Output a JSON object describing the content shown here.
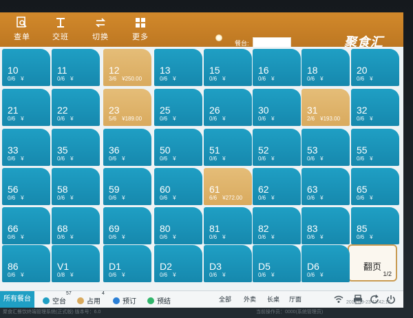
{
  "toolbar": {
    "tools": [
      {
        "label": "查单",
        "icon": "search-doc-icon"
      },
      {
        "label": "交班",
        "icon": "handover-icon"
      },
      {
        "label": "切换",
        "icon": "switch-icon"
      },
      {
        "label": "更多",
        "icon": "more-grid-icon"
      }
    ],
    "table_label": "餐台:",
    "table_input_value": "",
    "brand": "聚食汇"
  },
  "tiles": [
    {
      "name": "10",
      "guests": "0/6",
      "price": "¥",
      "status": "free"
    },
    {
      "name": "11",
      "guests": "0/6",
      "price": "¥",
      "status": "free"
    },
    {
      "name": "12",
      "guests": "3/6",
      "price": "¥250.00",
      "status": "occupied"
    },
    {
      "name": "13",
      "guests": "0/6",
      "price": "¥",
      "status": "free"
    },
    {
      "name": "15",
      "guests": "0/6",
      "price": "¥",
      "status": "free"
    },
    {
      "name": "16",
      "guests": "0/6",
      "price": "¥",
      "status": "free"
    },
    {
      "name": "18",
      "guests": "0/6",
      "price": "¥",
      "status": "free"
    },
    {
      "name": "20",
      "guests": "0/6",
      "price": "¥",
      "status": "free"
    },
    {
      "name": "21",
      "guests": "0/6",
      "price": "¥",
      "status": "free"
    },
    {
      "name": "22",
      "guests": "0/6",
      "price": "¥",
      "status": "free"
    },
    {
      "name": "23",
      "guests": "5/6",
      "price": "¥189.00",
      "status": "occupied"
    },
    {
      "name": "25",
      "guests": "0/6",
      "price": "¥",
      "status": "free"
    },
    {
      "name": "26",
      "guests": "0/6",
      "price": "¥",
      "status": "free"
    },
    {
      "name": "30",
      "guests": "0/6",
      "price": "¥",
      "status": "free"
    },
    {
      "name": "31",
      "guests": "2/6",
      "price": "¥193.00",
      "status": "occupied"
    },
    {
      "name": "32",
      "guests": "0/6",
      "price": "¥",
      "status": "free"
    },
    {
      "name": "33",
      "guests": "0/6",
      "price": "¥",
      "status": "free"
    },
    {
      "name": "35",
      "guests": "0/6",
      "price": "¥",
      "status": "free"
    },
    {
      "name": "36",
      "guests": "0/6",
      "price": "¥",
      "status": "free"
    },
    {
      "name": "50",
      "guests": "0/6",
      "price": "¥",
      "status": "free"
    },
    {
      "name": "51",
      "guests": "0/6",
      "price": "¥",
      "status": "free"
    },
    {
      "name": "52",
      "guests": "0/6",
      "price": "¥",
      "status": "free"
    },
    {
      "name": "53",
      "guests": "0/6",
      "price": "¥",
      "status": "free"
    },
    {
      "name": "55",
      "guests": "0/6",
      "price": "¥",
      "status": "free"
    },
    {
      "name": "56",
      "guests": "0/6",
      "price": "¥",
      "status": "free"
    },
    {
      "name": "58",
      "guests": "0/6",
      "price": "¥",
      "status": "free"
    },
    {
      "name": "59",
      "guests": "0/6",
      "price": "¥",
      "status": "free"
    },
    {
      "name": "60",
      "guests": "0/6",
      "price": "¥",
      "status": "free"
    },
    {
      "name": "61",
      "guests": "6/6",
      "price": "¥272.00",
      "status": "occupied"
    },
    {
      "name": "62",
      "guests": "0/6",
      "price": "¥",
      "status": "free"
    },
    {
      "name": "63",
      "guests": "0/6",
      "price": "¥",
      "status": "free"
    },
    {
      "name": "65",
      "guests": "0/6",
      "price": "¥",
      "status": "free"
    },
    {
      "name": "66",
      "guests": "0/6",
      "price": "¥",
      "status": "free"
    },
    {
      "name": "68",
      "guests": "0/6",
      "price": "¥",
      "status": "free"
    },
    {
      "name": "69",
      "guests": "0/6",
      "price": "¥",
      "status": "free"
    },
    {
      "name": "80",
      "guests": "0/6",
      "price": "¥",
      "status": "free"
    },
    {
      "name": "81",
      "guests": "0/6",
      "price": "¥",
      "status": "free"
    },
    {
      "name": "82",
      "guests": "0/6",
      "price": "¥",
      "status": "free"
    },
    {
      "name": "83",
      "guests": "0/6",
      "price": "¥",
      "status": "free"
    },
    {
      "name": "85",
      "guests": "0/6",
      "price": "¥",
      "status": "free"
    },
    {
      "name": "86",
      "guests": "0/6",
      "price": "¥",
      "status": "free"
    },
    {
      "name": "V1",
      "guests": "0/8",
      "price": "¥",
      "status": "free"
    },
    {
      "name": "D1",
      "guests": "0/6",
      "price": "¥",
      "status": "free"
    },
    {
      "name": "D2",
      "guests": "0/6",
      "price": "¥",
      "status": "free"
    },
    {
      "name": "D3",
      "guests": "0/6",
      "price": "¥",
      "status": "free"
    },
    {
      "name": "D5",
      "guests": "0/6",
      "price": "¥",
      "status": "free"
    },
    {
      "name": "D6",
      "guests": "0/6",
      "price": "¥",
      "status": "free"
    }
  ],
  "pager": {
    "label": "翻页",
    "page": "1/2"
  },
  "bottombar": {
    "all_tables": "所有餐台",
    "legend": [
      {
        "label": "空台",
        "count": "57",
        "color": "#1f9fc4"
      },
      {
        "label": "占用",
        "count": "4",
        "color": "#d9aa5e"
      },
      {
        "label": "预订",
        "count": "",
        "color": "#2a7fd6"
      },
      {
        "label": "预结",
        "count": "",
        "color": "#31b56b"
      }
    ],
    "filters": [
      "全部",
      "外卖",
      "长桌",
      "厅面"
    ],
    "icons": [
      "wifi-icon",
      "printer-icon",
      "refresh-icon",
      "power-icon"
    ],
    "datetime": "2016-09-23 11:42:15"
  },
  "statusline": {
    "left": "聚食汇餐饮终端管理系统(正式版) 版本号：6.0",
    "right": "当前操作员：0000(系统管理员)"
  },
  "colors": {
    "accent": "#c9812a",
    "free": "#1f9fc4",
    "occupied": "#d9aa5e"
  }
}
